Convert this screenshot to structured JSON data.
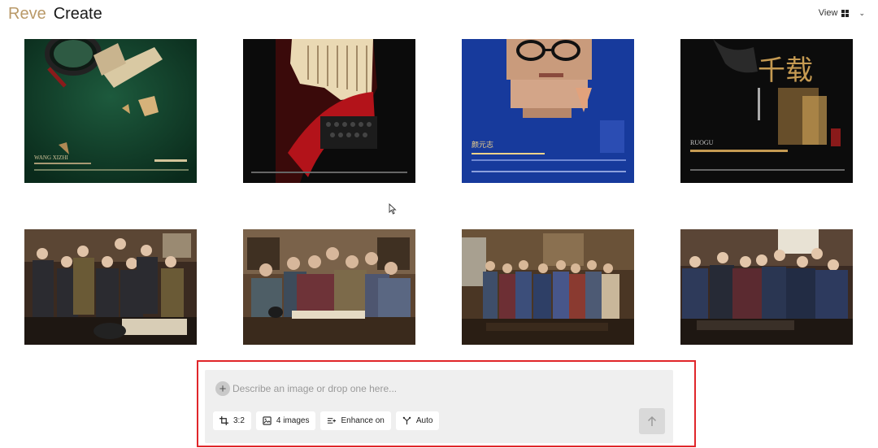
{
  "header": {
    "brand": "Reve",
    "section": "Create",
    "view_label": "View"
  },
  "gallery": {
    "items": [
      {
        "name": "thumbnail-1",
        "poster_text": "WANG XIZHI"
      },
      {
        "name": "thumbnail-2"
      },
      {
        "name": "thumbnail-3",
        "poster_text": "颜元志"
      },
      {
        "name": "thumbnail-4",
        "poster_text": "千载",
        "poster_subtext": "RUOGU"
      },
      {
        "name": "thumbnail-5"
      },
      {
        "name": "thumbnail-6"
      },
      {
        "name": "thumbnail-7"
      },
      {
        "name": "thumbnail-8"
      }
    ]
  },
  "composer": {
    "placeholder": "Describe an image or drop one here...",
    "chips": {
      "aspect": "3:2",
      "count": "4 images",
      "enhance": "Enhance on",
      "model": "Auto"
    }
  },
  "colors": {
    "brand": "#b99968",
    "highlight": "#e0262a",
    "composer_bg": "#efefef"
  }
}
